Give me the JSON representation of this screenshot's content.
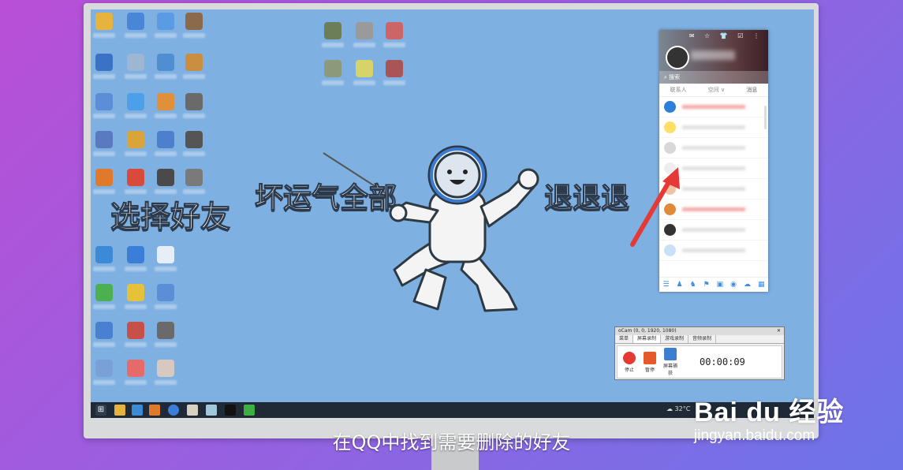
{
  "video_subtitle": "在QQ中找到需要删除的好友",
  "overlay_callout": "选择好友",
  "wallpaper_text_left": "坏运气全部",
  "wallpaper_text_right": "退退退",
  "watermark": {
    "brand": "Bai du 经验",
    "url": "jingyan.baidu.com"
  },
  "qq_panel": {
    "search_placeholder": "搜索",
    "tabs": [
      "联系人",
      "空间 ∨",
      "消息"
    ],
    "top_icons": "✉ ☆ 👕 ☑ ⋮",
    "avatar_colors": [
      "#2d7fd8",
      "#ffe066",
      "#d8d8d8",
      "#eeeeee",
      "#f1c3a5",
      "#e08a3c",
      "#333333",
      "#c9e1f7",
      "#dddddd"
    ],
    "bottom_icons": [
      "☰",
      "♟",
      "♞",
      "⚑",
      "▣",
      "◉",
      "☁",
      "▦"
    ]
  },
  "ocam": {
    "title": "oCam (0, 0, 1920, 1080)",
    "close_glyph": "✕",
    "tabs": [
      "菜单",
      "屏幕录制",
      "游戏录制",
      "音频录制"
    ],
    "buttons": [
      "停止",
      "暂停",
      "屏幕捕获"
    ],
    "timer": "00:00:09"
  },
  "taskbar": {
    "temperature": "32°C"
  },
  "colors": {
    "accent_red": "#e53935",
    "taskbar": "#1f2a36",
    "desktop": "#7fb0e2"
  }
}
